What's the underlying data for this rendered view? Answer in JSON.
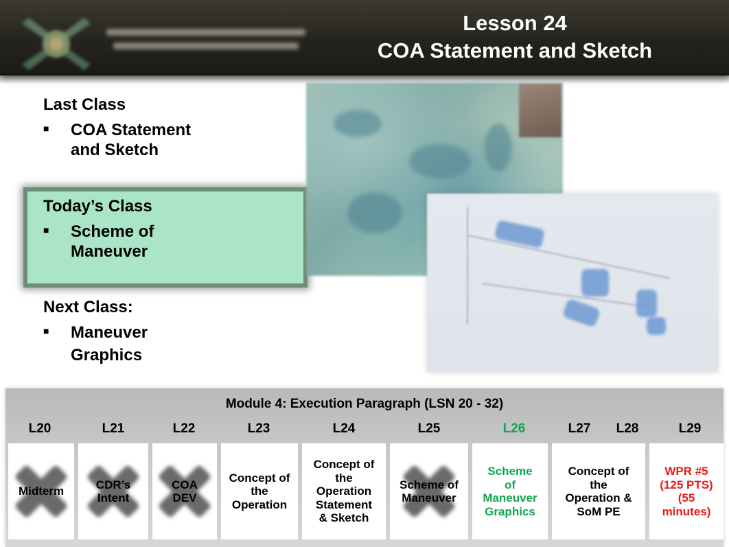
{
  "header": {
    "title_line1": "Lesson 24",
    "title_line2": "COA Statement and Sketch",
    "logo": "unit-crest-logo"
  },
  "last_class": {
    "heading": "Last Class",
    "bullet_icon": "square-bullet",
    "items": [
      "COA Statement and Sketch"
    ],
    "item_lines": [
      "COA Statement",
      "and Sketch"
    ]
  },
  "todays_class": {
    "heading": "Today’s Class",
    "bullet_icon": "square-bullet",
    "items": [
      "Scheme of Maneuver"
    ],
    "item_lines": [
      "Scheme of",
      "Maneuver"
    ],
    "highlight_color": "#a9e5c6"
  },
  "next_class": {
    "heading": "Next Class:",
    "bullet_icon": "square-bullet",
    "items": [
      "Maneuver Graphics"
    ],
    "item_lines": [
      "Maneuver",
      "Graphics"
    ]
  },
  "images": {
    "terrain_map": "terrain-map-photo",
    "coa_sketch": "coa-sketch-diagram"
  },
  "module": {
    "title": "Module 4: Execution Paragraph (LSN 20 - 32)",
    "lessons": [
      {
        "id": "L20",
        "text": "Midterm",
        "lines": [
          "Midterm"
        ],
        "crossed": true,
        "color": "#000000"
      },
      {
        "id": "L21",
        "text": "CDR’s Intent",
        "lines": [
          "CDR’s",
          "Intent"
        ],
        "crossed": true,
        "color": "#000000"
      },
      {
        "id": "L22",
        "text": "COA DEV",
        "lines": [
          "COA",
          "DEV"
        ],
        "crossed": true,
        "color": "#000000"
      },
      {
        "id": "L23",
        "text": "Concept of the Operation",
        "lines": [
          "Concept of",
          "the",
          "Operation"
        ],
        "crossed": false,
        "color": "#000000"
      },
      {
        "id": "L24",
        "text": "Concept of the Operation Statement & Sketch",
        "lines": [
          "Concept of",
          "the",
          "Operation",
          "Statement",
          "& Sketch"
        ],
        "crossed": false,
        "color": "#000000"
      },
      {
        "id": "L25",
        "text": "Scheme of Maneuver",
        "lines": [
          "Scheme of",
          "Maneuver"
        ],
        "crossed": true,
        "color": "#000000"
      },
      {
        "id": "L26",
        "text": "Scheme of Maneuver Graphics",
        "lines": [
          "Scheme",
          "of",
          "Maneuver",
          "Graphics"
        ],
        "crossed": false,
        "color": "#10a64e"
      },
      {
        "id": "L27",
        "text": "Concept of the Operation & SoM PE",
        "lines": [
          "Concept of",
          "the",
          "Operation &",
          "SoM PE"
        ],
        "crossed": false,
        "color": "#000000"
      },
      {
        "id": "L28",
        "text": "",
        "lines": [],
        "crossed": false,
        "color": "#000000"
      },
      {
        "id": "L29",
        "text": "WPR #5 (125 PTS) (55 minutes)",
        "lines": [
          "WPR #5",
          "(125 PTS)",
          "(55",
          "minutes)"
        ],
        "crossed": false,
        "color": "#e41b17"
      }
    ]
  }
}
